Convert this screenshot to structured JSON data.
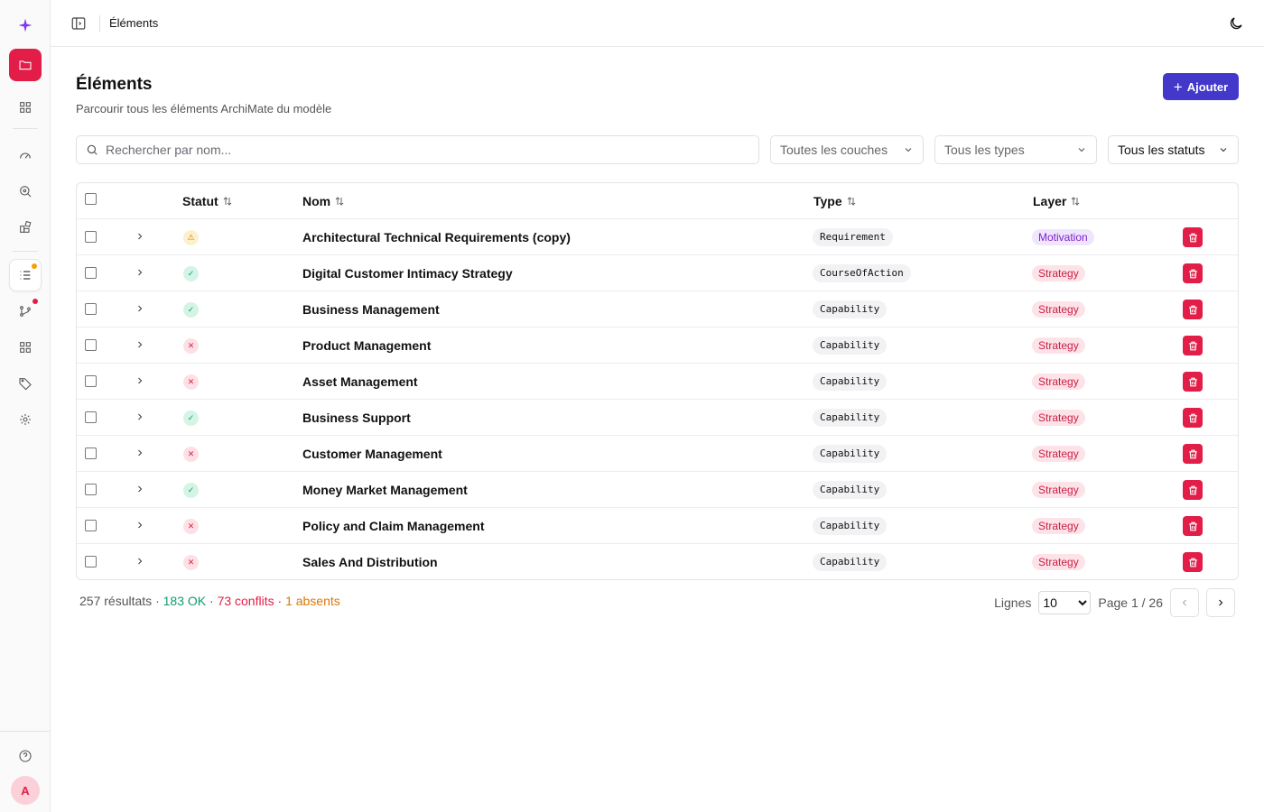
{
  "topbar": {
    "breadcrumb": "Éléments"
  },
  "page": {
    "title": "Éléments",
    "subtitle": "Parcourir tous les éléments ArchiMate du modèle",
    "add_label": "Ajouter"
  },
  "filters": {
    "search_placeholder": "Rechercher par nom...",
    "layers": "Toutes les couches",
    "types": "Tous les types",
    "statuses": "Tous les statuts"
  },
  "table": {
    "headers": {
      "status": "Statut",
      "name": "Nom",
      "type": "Type",
      "layer": "Layer"
    },
    "rows": [
      {
        "status": "warning",
        "status_glyph": "⚠",
        "name": "Architectural Technical Requirements (copy)",
        "type": "Requirement",
        "layer": "Motivation"
      },
      {
        "status": "ok",
        "status_glyph": "✓",
        "name": "Digital Customer Intimacy Strategy",
        "type": "CourseOfAction",
        "layer": "Strategy"
      },
      {
        "status": "ok",
        "status_glyph": "✓",
        "name": "Business Management",
        "type": "Capability",
        "layer": "Strategy"
      },
      {
        "status": "conflict",
        "status_glyph": "✕",
        "name": "Product Management",
        "type": "Capability",
        "layer": "Strategy"
      },
      {
        "status": "conflict",
        "status_glyph": "✕",
        "name": "Asset Management",
        "type": "Capability",
        "layer": "Strategy"
      },
      {
        "status": "ok",
        "status_glyph": "✓",
        "name": "Business Support",
        "type": "Capability",
        "layer": "Strategy"
      },
      {
        "status": "conflict",
        "status_glyph": "✕",
        "name": "Customer Management",
        "type": "Capability",
        "layer": "Strategy"
      },
      {
        "status": "ok",
        "status_glyph": "✓",
        "name": "Money Market Management",
        "type": "Capability",
        "layer": "Strategy"
      },
      {
        "status": "conflict",
        "status_glyph": "✕",
        "name": "Policy and Claim Management",
        "type": "Capability",
        "layer": "Strategy"
      },
      {
        "status": "conflict",
        "status_glyph": "✕",
        "name": "Sales And Distribution",
        "type": "Capability",
        "layer": "Strategy"
      }
    ]
  },
  "footer": {
    "results": "257 résultats",
    "sep": "·",
    "ok": "183 OK",
    "conflicts": "73 conflits",
    "absent": "1 absents"
  },
  "pagination": {
    "rows_label": "Lignes",
    "rows_value": "10",
    "page": "Page 1 / 26"
  },
  "user": {
    "avatar_initial": "A"
  },
  "colors": {
    "accent_red": "#e11d48",
    "primary": "#4338ca",
    "ok": "#0f9d6b",
    "warn": "#d97706"
  }
}
